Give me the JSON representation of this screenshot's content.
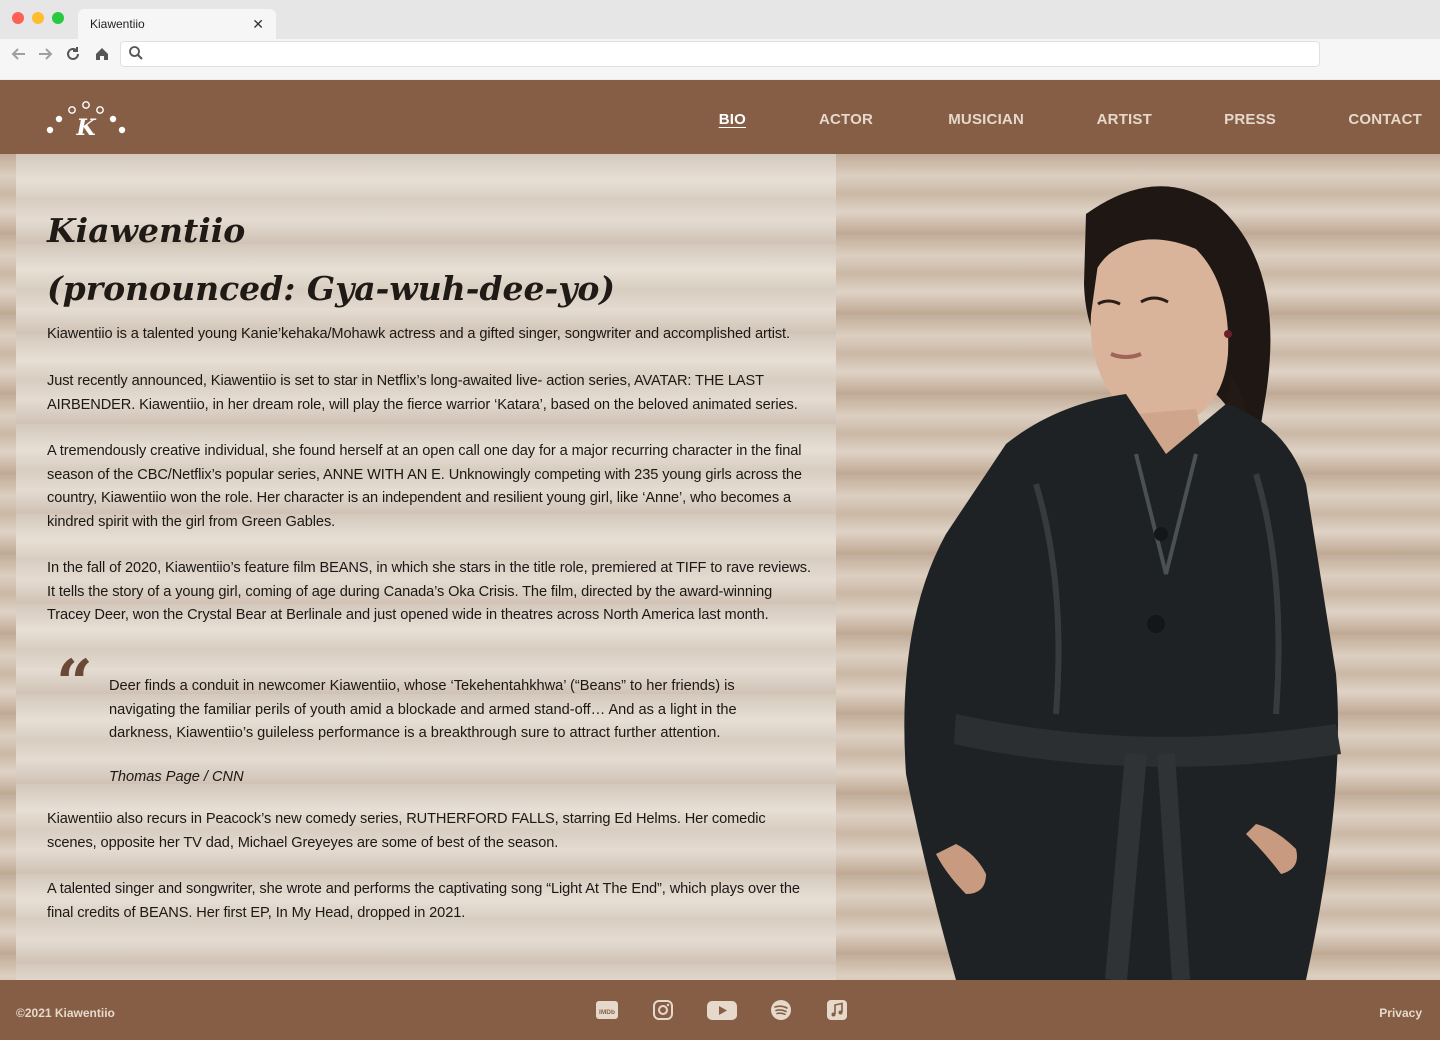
{
  "browser": {
    "tab_title": "Kiawentiio",
    "tab_close": "✕",
    "url": ""
  },
  "header": {
    "logo_letter": "K",
    "nav": [
      {
        "label": "BIO",
        "active": true
      },
      {
        "label": "ACTOR",
        "active": false
      },
      {
        "label": "MUSICIAN",
        "active": false
      },
      {
        "label": "ARTIST",
        "active": false
      },
      {
        "label": "PRESS",
        "active": false
      },
      {
        "label": "CONTACT",
        "active": false
      }
    ]
  },
  "bio": {
    "heading_line1": "Kiawentiio",
    "heading_line2_prefix": "(pronounced: ",
    "heading_line2_em": "Gya-wuh-dee-yo",
    "heading_line2_suffix": ")",
    "paragraphs": [
      "Kiawentiio is a talented young Kanie’kehaka/Mohawk actress and a gifted singer, songwriter and accomplished artist.",
      "Just recently announced, Kiawentiio is set to star in Netflix’s long-awaited live- action series, AVATAR: THE LAST AIRBENDER. Kiawentiio, in her dream role, will play the fierce warrior ‘Katara’, based on the beloved animated series.",
      "A tremendously creative individual, she found herself at an open call one day for a major recurring character in the final season of the CBC/Netflix’s popular series, ANNE WITH AN E. Unknowingly competing with 235 young girls across the country, Kiawentiio won the role. Her character is an independent and resilient young girl, like ‘Anne’, who becomes a kindred spirit with the girl from Green Gables.",
      "In the fall of 2020, Kiawentiio’s feature film BEANS, in which she stars in the title role, premiered at TIFF to rave reviews. It tells the story of a young girl, coming of age during Canada’s Oka Crisis. The film, directed by the award-winning Tracey Deer, won the Crystal Bear at Berlinale and just opened wide in theatres across North America last month.",
      "Kiawentiio also recurs in Peacock’s new comedy series, RUTHERFORD FALLS, starring Ed Helms. Her comedic scenes, opposite her TV dad, Michael Greyeyes are some of best of the season.",
      "A talented singer and songwriter, she wrote and performs the captivating song “Light At The End”, which plays over the final credits of BEANS. Her first EP, In My Head, dropped in 2021."
    ],
    "quote": {
      "mark": "“",
      "text": "Deer finds a conduit in newcomer Kiawentiio, whose ‘Tekehentahkhwa’ (“Beans” to her friends) is navigating the familiar perils of youth amid a blockade and armed stand-off… And as a light in the darkness, Kiawentiio’s guileless performance is a breakthrough sure to attract further attention.",
      "cite": "Thomas Page / CNN"
    }
  },
  "footer": {
    "copyright": "©2021 Kiawentiio",
    "privacy": "Privacy",
    "social": [
      "imdb-icon",
      "instagram-icon",
      "youtube-icon",
      "spotify-icon",
      "apple-music-icon"
    ],
    "imdb_text": "IMDb"
  },
  "colors": {
    "brand_brown": "#865e45",
    "nav_text": "#e6d9cc"
  }
}
